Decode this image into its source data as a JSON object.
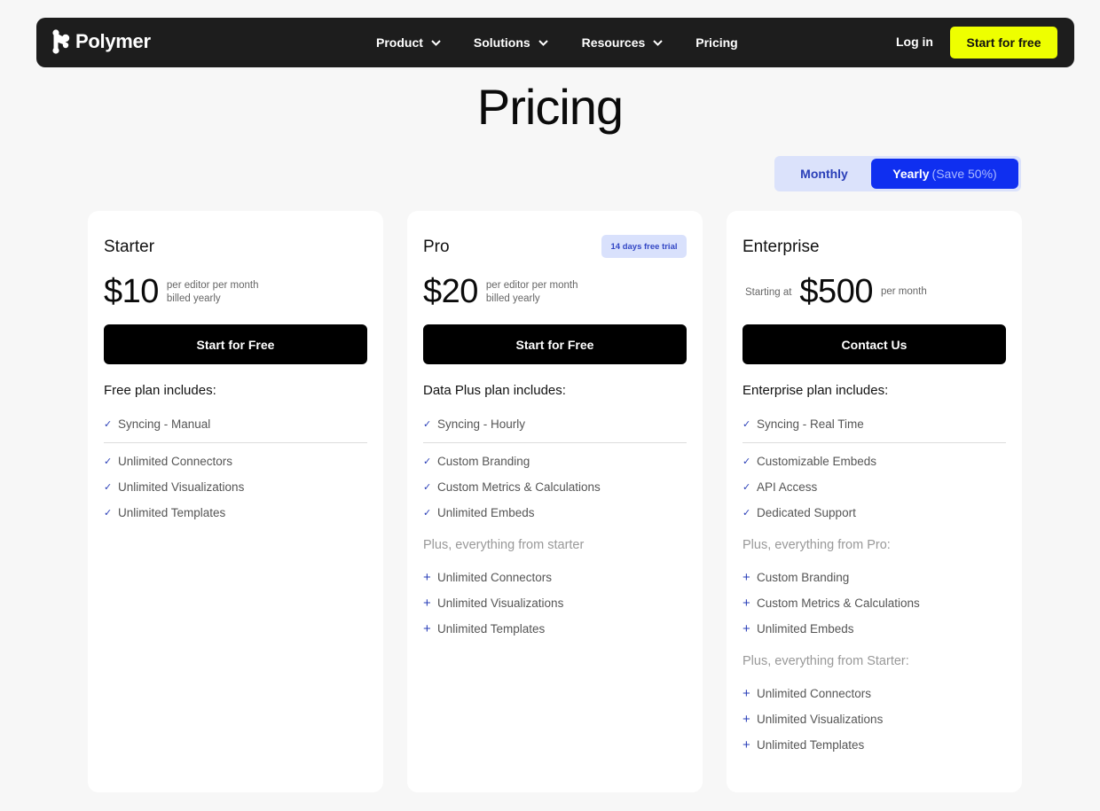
{
  "nav": {
    "brand": "Polymer",
    "links": [
      {
        "label": "Product",
        "has_dropdown": true
      },
      {
        "label": "Solutions",
        "has_dropdown": true
      },
      {
        "label": "Resources",
        "has_dropdown": true
      },
      {
        "label": "Pricing",
        "has_dropdown": false
      }
    ],
    "login": "Log in",
    "cta": "Start for free"
  },
  "page": {
    "title": "Pricing"
  },
  "billing": {
    "monthly": "Monthly",
    "yearly": "Yearly",
    "yearly_note": "(Save 50%)",
    "selected": "Yearly"
  },
  "plans": [
    {
      "name": "Starter",
      "price": "$10",
      "price_note_line1": "per editor per month",
      "price_note_line2": "billed yearly",
      "button": "Start for Free",
      "includes_title": "Free plan includes:",
      "first_feature": "Syncing - Manual",
      "features": [
        "Unlimited Connectors",
        "Unlimited Visualizations",
        "Unlimited Templates"
      ]
    },
    {
      "name": "Pro",
      "badge": "14 days free trial",
      "price": "$20",
      "price_note_line1": "per editor per month",
      "price_note_line2": "billed yearly",
      "button": "Start for Free",
      "includes_title": "Data Plus plan includes:",
      "first_feature": "Syncing - Hourly",
      "features": [
        "Custom Branding",
        "Custom Metrics & Calculations",
        "Unlimited Embeds"
      ],
      "plus_sections": [
        {
          "heading": "Plus, everything from starter",
          "items": [
            "Unlimited Connectors",
            "Unlimited Visualizations",
            "Unlimited Templates"
          ]
        }
      ]
    },
    {
      "name": "Enterprise",
      "starting_at": "Starting at",
      "price": "$500",
      "price_note_line1": "per month",
      "button": "Contact Us",
      "includes_title": "Enterprise plan includes:",
      "first_feature": "Syncing - Real Time",
      "features": [
        "Customizable Embeds",
        "API Access",
        "Dedicated Support"
      ],
      "plus_sections": [
        {
          "heading": "Plus, everything from Pro:",
          "items": [
            "Custom Branding",
            "Custom Metrics & Calculations",
            "Unlimited Embeds"
          ]
        },
        {
          "heading": "Plus, everything from Starter:",
          "items": [
            "Unlimited Connectors",
            "Unlimited Visualizations",
            "Unlimited Templates"
          ]
        }
      ]
    }
  ],
  "icons": {
    "check": "✓",
    "plus": "+"
  },
  "colors": {
    "background": "#f7f7f7",
    "nav_bg": "#1d1d1d",
    "cta_yellow": "#eeff00",
    "accent_blue": "#0f2ff0",
    "toggle_bg": "#dbe2fb",
    "badge_bg": "#d9e1fc"
  }
}
